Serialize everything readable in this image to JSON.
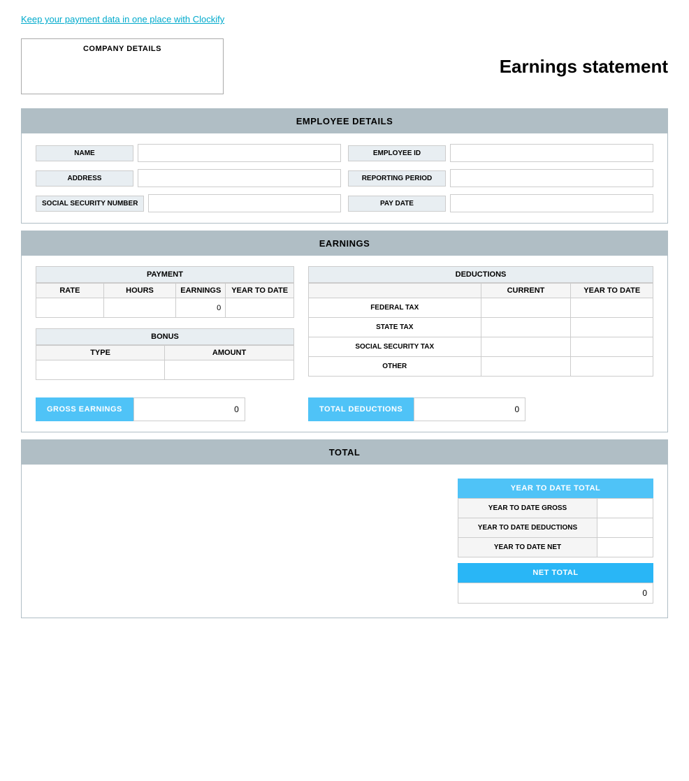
{
  "topLink": {
    "text": "Keep your payment data in one place with Clockify"
  },
  "title": "Earnings statement",
  "companyDetails": {
    "label": "COMPANY DETAILS"
  },
  "employeeDetails": {
    "sectionLabel": "EMPLOYEE DETAILS",
    "fields": {
      "name": {
        "label": "NAME",
        "value": ""
      },
      "address": {
        "label": "ADDRESS",
        "value": ""
      },
      "ssn": {
        "label": "SOCIAL SECURITY NUMBER",
        "value": ""
      },
      "employeeId": {
        "label": "EMPLOYEE ID",
        "value": ""
      },
      "reportingPeriod": {
        "label": "REPORTING PERIOD",
        "value": ""
      },
      "payDate": {
        "label": "PAY DATE",
        "value": ""
      }
    }
  },
  "earnings": {
    "sectionLabel": "EARNINGS",
    "payment": {
      "label": "PAYMENT",
      "columns": [
        "RATE",
        "HOURS",
        "EARNINGS",
        "YEAR TO DATE"
      ],
      "row": {
        "rate": "",
        "hours": "",
        "earnings": "0",
        "ytd": ""
      }
    },
    "bonus": {
      "label": "BONUS",
      "columns": [
        "TYPE",
        "AMOUNT"
      ],
      "row": {
        "type": "",
        "amount": ""
      }
    },
    "deductions": {
      "label": "DEDUCTIONS",
      "columns": [
        "CURRENT",
        "YEAR TO DATE"
      ],
      "rows": [
        {
          "label": "FEDERAL TAX",
          "current": "",
          "ytd": ""
        },
        {
          "label": "STATE TAX",
          "current": "",
          "ytd": ""
        },
        {
          "label": "SOCIAL SECURITY TAX",
          "current": "",
          "ytd": ""
        },
        {
          "label": "OTHER",
          "current": "",
          "ytd": ""
        }
      ]
    },
    "grossEarnings": {
      "label": "GROSS EARNINGS",
      "value": "0"
    },
    "totalDeductions": {
      "label": "TOTAL DEDUCTIONS",
      "value": "0"
    }
  },
  "total": {
    "sectionLabel": "TOTAL",
    "ytdTotal": {
      "header": "YEAR TO DATE TOTAL",
      "rows": [
        {
          "label": "YEAR TO DATE GROSS",
          "value": ""
        },
        {
          "label": "YEAR TO DATE DEDUCTIONS",
          "value": ""
        },
        {
          "label": "YEAR TO DATE NET",
          "value": ""
        }
      ]
    },
    "netTotal": {
      "label": "NET TOTAL",
      "value": "0"
    }
  }
}
